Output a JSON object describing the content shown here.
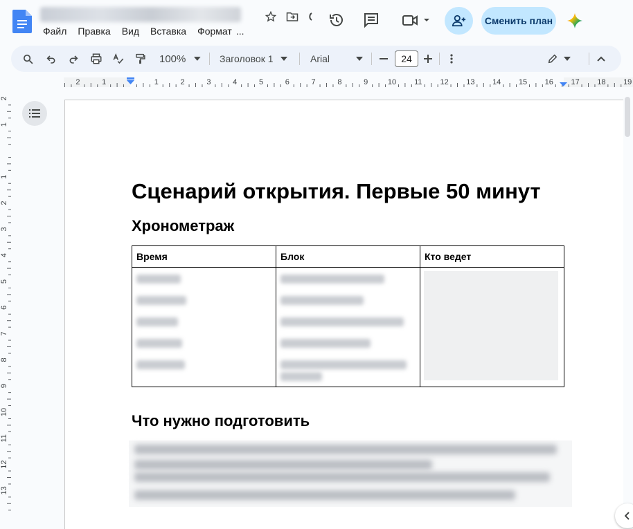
{
  "header": {
    "menu": [
      "Файл",
      "Правка",
      "Вид",
      "Вставка",
      "Формат",
      "..."
    ],
    "plan_button": "Сменить план"
  },
  "toolbar": {
    "zoom": "100%",
    "style": "Заголовок 1",
    "font": "Arial",
    "font_size": "24"
  },
  "ruler": {
    "horizontal": [
      "2",
      "1",
      "1",
      "2",
      "3",
      "4",
      "5",
      "6",
      "7",
      "8",
      "9",
      "10",
      "11",
      "12",
      "13",
      "14",
      "15",
      "16",
      "17",
      "18",
      "19"
    ],
    "vertical": [
      "2",
      "1",
      "1",
      "2",
      "3",
      "4",
      "5",
      "6",
      "7",
      "8",
      "9",
      "10",
      "11",
      "12",
      "13"
    ]
  },
  "document": {
    "title": "Сценарий открытия. Первые 50 минут",
    "section1": "Хронометраж",
    "table_headers": [
      "Время",
      "Блок",
      "Кто ведет"
    ],
    "section2": "Что нужно подготовить"
  },
  "colors": {
    "accent_button": "#c2e7ff",
    "toolbar_bg": "#edf2fa",
    "app_bg": "#f9fbfd",
    "docs_blue": "#4285f4"
  },
  "icons": [
    "docs-logo-icon",
    "star-icon",
    "move-to-folder-icon",
    "cloud-status-icon",
    "history-icon",
    "comments-icon",
    "meet-icon",
    "add-people-icon",
    "gemini-icon",
    "search-icon",
    "undo-icon",
    "redo-icon",
    "print-icon",
    "spellcheck-icon",
    "paint-format-icon",
    "more-vert-icon",
    "edit-mode-icon",
    "collapse-icon",
    "outline-icon",
    "chevron-right-icon"
  ]
}
